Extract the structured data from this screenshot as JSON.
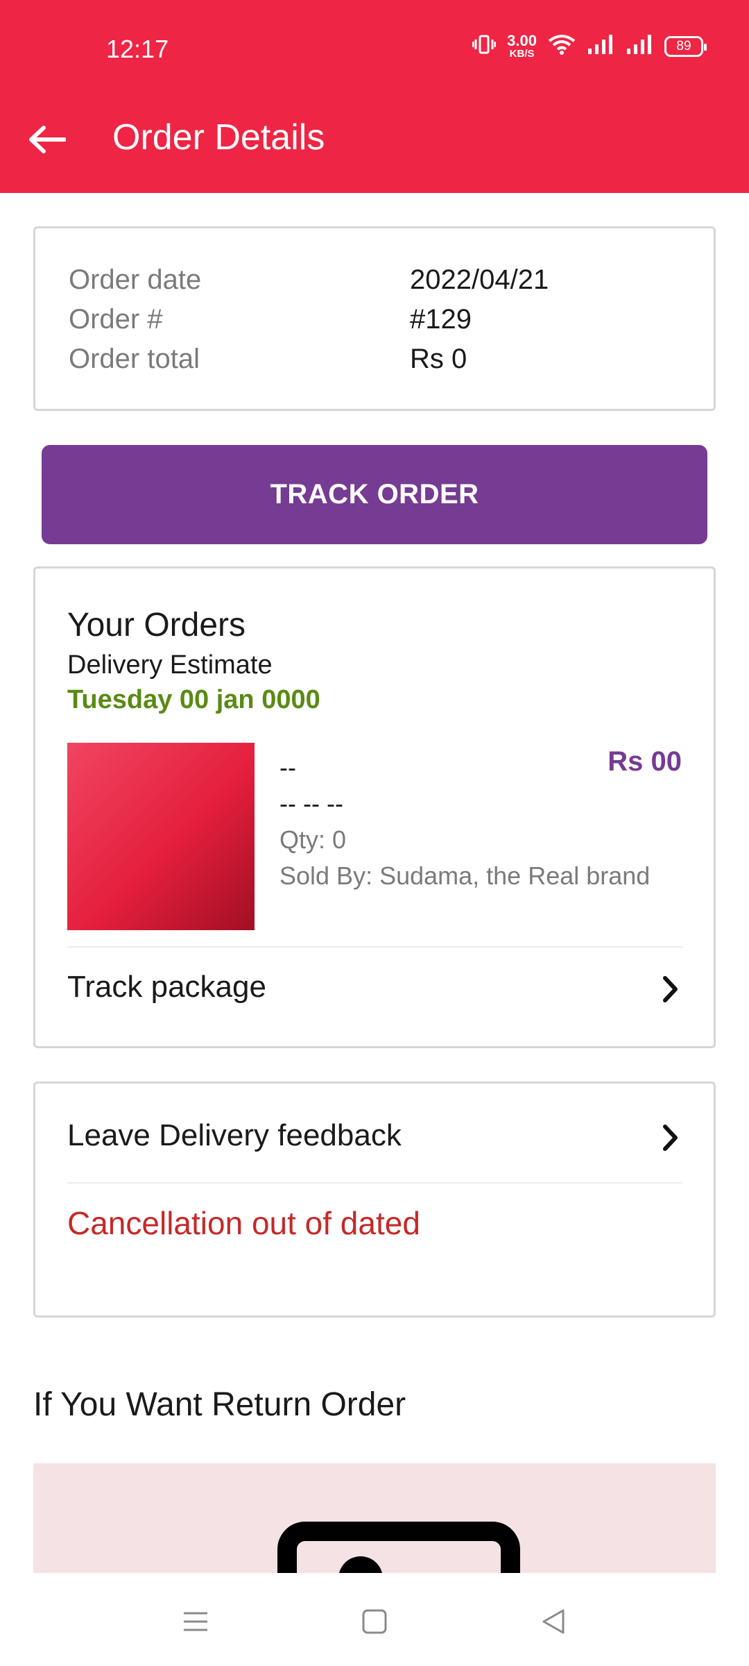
{
  "status_bar": {
    "time": "12:17",
    "net_speed_value": "3.00",
    "net_speed_unit": "KB/S",
    "battery": "89",
    "icons": [
      "vibrate-icon",
      "wifi-icon",
      "signal-icon",
      "signal-icon",
      "battery-icon"
    ]
  },
  "app_bar": {
    "title": "Order Details",
    "back_icon": "arrow-left-icon",
    "background": "#ee2544"
  },
  "summary": {
    "rows": [
      {
        "label": "Order date",
        "value": "2022/04/21"
      },
      {
        "label": "Order #",
        "value": "#129"
      },
      {
        "label": "Order total",
        "value": "Rs 0"
      }
    ]
  },
  "track_order_button": {
    "label": "TRACK ORDER",
    "color": "#763b92"
  },
  "orders": {
    "title": "Your Orders",
    "delivery_label": "Delivery Estimate",
    "delivery_date": "Tuesday 00 jan 0000",
    "item": {
      "name": "--",
      "variant": "-- -- --",
      "price": "Rs 00",
      "qty": "Qty: 0",
      "sold_by": "Sold By: Sudama, the Real brand"
    },
    "track_package": "Track package"
  },
  "feedback": {
    "label": "Leave Delivery feedback",
    "cancellation": "Cancellation out of dated"
  },
  "return": {
    "title": "If You Want Return Order"
  },
  "nav": {
    "icons": [
      "menu-icon",
      "home-square-icon",
      "back-triangle-icon"
    ]
  }
}
